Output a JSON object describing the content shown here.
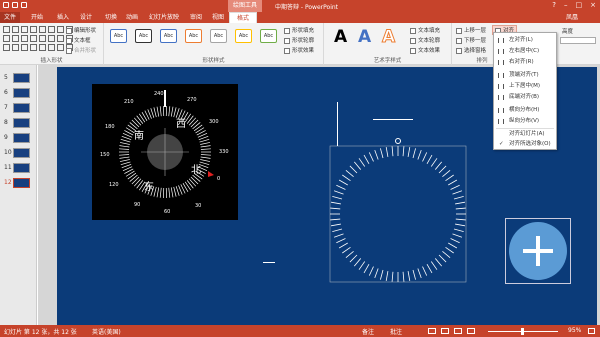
{
  "window": {
    "title": "中期答辩 - PowerPoint",
    "context_tab": "绘图工具",
    "user": "凤凰"
  },
  "tabs": [
    {
      "label": "文件"
    },
    {
      "label": "开始"
    },
    {
      "label": "插入"
    },
    {
      "label": "设计"
    },
    {
      "label": "切换"
    },
    {
      "label": "动画"
    },
    {
      "label": "幻灯片放映"
    },
    {
      "label": "审阅"
    },
    {
      "label": "视图"
    },
    {
      "label": "格式"
    }
  ],
  "ribbon": {
    "insert_shapes": {
      "label": "插入形状",
      "edit_shape": "编辑形状",
      "text_box": "文本框",
      "merge_shapes": "合并形状"
    },
    "shape_styles": {
      "label": "形状样式",
      "style_text": "Abc",
      "fill": "形状填充",
      "outline": "形状轮廓",
      "effects": "形状效果"
    },
    "wordart": {
      "label": "艺术字样式",
      "glyph": "A",
      "text_fill": "文本填充",
      "text_outline": "文本轮廓",
      "text_effects": "文本效果"
    },
    "arrange": {
      "label": "排列",
      "bring_forward": "上移一层",
      "send_backward": "下移一层",
      "selection_pane": "选择窗格",
      "align": "对齐",
      "height_label": "高度"
    }
  },
  "align_menu": {
    "items": [
      "左对齐(L)",
      "左右居中(C)",
      "右对齐(R)",
      "顶端对齐(T)",
      "上下居中(M)",
      "底端对齐(B)",
      "横向分布(H)",
      "纵向分布(V)",
      "对齐幻灯片(A)",
      "对齐所选对象(O)"
    ]
  },
  "slides": [
    {
      "number": "5"
    },
    {
      "number": "6"
    },
    {
      "number": "7"
    },
    {
      "number": "8"
    },
    {
      "number": "9"
    },
    {
      "number": "10"
    },
    {
      "number": "11"
    },
    {
      "number": "12"
    }
  ],
  "compass": {
    "dir_north": "北",
    "dir_south": "南",
    "dir_east": "东",
    "dir_west": "西",
    "degrees": [
      "0",
      "30",
      "60",
      "90",
      "120",
      "150",
      "180",
      "210",
      "240",
      "270",
      "300",
      "330"
    ]
  },
  "status": {
    "slide_info": "幻灯片 第 12 张，共 12 张",
    "language": "英语(美国)",
    "notes": "备注",
    "comments": "批注",
    "zoom": "95%"
  },
  "colors": {
    "accent": "#c6432b",
    "slide_bg": "#0b3b79",
    "circle_fill": "#5b9bd5"
  }
}
